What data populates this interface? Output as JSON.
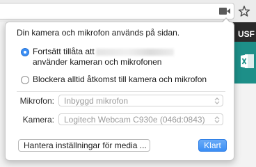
{
  "browser": {
    "camera_icon": "video-camera-icon",
    "bookmark_icon": "star-icon"
  },
  "background_page": {
    "corner_text": "USF",
    "tile_icon": "excel-icon",
    "colors": {
      "dark": "#2a2a2a",
      "teal": "#1d8f88"
    }
  },
  "popup": {
    "title": "Din kamera och mikrofon används på sidan.",
    "options": [
      {
        "line1": "Fortsätt tillåta att",
        "line2": "använder kameran och mikrofonen",
        "selected": true
      },
      {
        "line1": "Blockera alltid åtkomst till kamera och mikrofon",
        "selected": false
      }
    ],
    "microphone": {
      "label": "Mikrofon:",
      "value": "Inbyggd mikrofon"
    },
    "camera": {
      "label": "Kamera:",
      "value": "Logitech Webcam C930e (046d:0843)"
    },
    "manage_button": "Hantera inställningar för media ...",
    "done_button": "Klart",
    "accent_color": "#3a8ef5"
  }
}
